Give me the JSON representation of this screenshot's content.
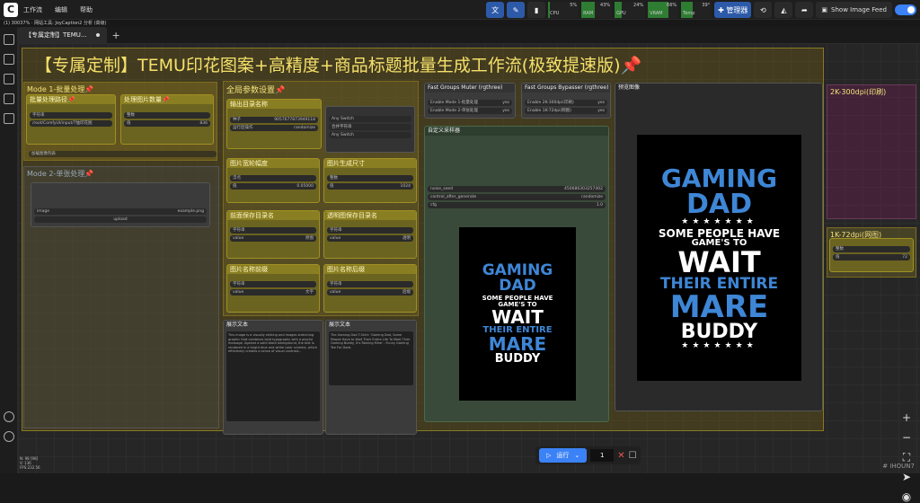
{
  "menubar": {
    "items": [
      "工作流",
      "编辑",
      "帮助"
    ],
    "meters": [
      {
        "label": "CPU",
        "pct": "5%",
        "value": 0.05,
        "color": "#2e7d32"
      },
      {
        "label": "RAM",
        "pct": "43%",
        "value": 0.43,
        "color": "#2e7d32"
      },
      {
        "label": "GPU",
        "pct": "24%",
        "value": 0.24,
        "color": "#2e7d32"
      },
      {
        "label": "VRAM",
        "pct": "66%",
        "value": 0.66,
        "color": "#2e7d32"
      },
      {
        "label": "Temp",
        "pct": "39°",
        "value": 0.39,
        "color": "#2e7d32"
      }
    ],
    "manager": "管理器",
    "feed": "Show Image Feed"
  },
  "queue": "(1) 30037% · 网站工具: JoyCaption2 分析 (高级)",
  "tab": {
    "label": "【专属定制】TEMU..."
  },
  "main_title": "【专属定制】TEMU印花图案+高精度+商品标题批量生成工作流(极致提速版)📌",
  "groups": {
    "mode1": "Mode 1-批量处理📌",
    "mode2": "Mode 2-单张处理📌",
    "global": "全局参数设置📌",
    "g300": "2K-300dpi(印刷)",
    "g72": "1K-72dpi(网图)"
  },
  "nodes": {
    "batch_path": "批量处理路径📌",
    "batch_count": "处理图片数量📌",
    "output_dir": "输出目录名称",
    "img_width": "图片宽轮幅度",
    "img_size": "图片生成尺寸",
    "bg_dir": "前面保存目录名",
    "transparent_dir": "透明图保存目录名",
    "prefix": "图片名称前缀",
    "suffix": "图片名称后缀",
    "fast_mute": "Fast Groups Muter (rgthree)",
    "fast_bypass": "Fast Groups Bypasser (rgthree)",
    "preview": "预览图像",
    "sampler": "自定义采样器",
    "show_text1": "展示文本",
    "show_text2": "展示文本"
  },
  "widgets": {
    "path_value": "/root/ComfyUI/input/T恤印花图",
    "count_value": "836",
    "seed": "9057677873949118",
    "control": "randomize",
    "width_value": "0.05000",
    "size_value": "1024",
    "bg_value": "原图",
    "trans_value": "透明",
    "prefix_value": "文字",
    "suffix_value": "后缀",
    "sampler_seed": "450686303257402",
    "cfg": "1.0",
    "mode1_toggle": "Enable Mode 1-批量处理",
    "mode2_toggle": "Enable Mode 2-单张处理",
    "k2_toggle": "Enable 2K-300dpi(印刷)",
    "k1_toggle": "Enable 1K-72dpi(网图)",
    "yes": "yes",
    "k1_value": "72",
    "image_file": "example.png",
    "upload": "upload"
  },
  "text_output": {
    "left": "This image is a visually striking and images stretching graphic that combines bold typography with a playful message. Against a solid black background, the text is rendered in a bright blue and white color scheme, which effectively creates a sense of visual contrast...",
    "right": "The Gaming Dad T-Shirt: 'Gaming Dad, Some People Have to Wait Their Entire Life To Meet Their Gaming Buddy, It's Raining Mine' - Funny Gaming Tee For Dads"
  },
  "shirt": {
    "line1": "GAMING",
    "line2": "DAD",
    "line3": "SOME PEOPLE HAVE",
    "line4": "GAME'S TO",
    "line5": "WAIT",
    "line6": "THEIR ENTIRE",
    "line7": "MARE",
    "line8": "BUDDY"
  },
  "run": {
    "label": "运行",
    "count": "1"
  },
  "watermark": "# IHOUN7",
  "sidebar_info": {
    "n": "N: 98 [98]",
    "v": "V: 136",
    "fps": "FPS:232.56"
  },
  "colors": {
    "accent": "#3b82f6",
    "group": "#f3e27a",
    "shirt_blue": "#3e86d6"
  }
}
